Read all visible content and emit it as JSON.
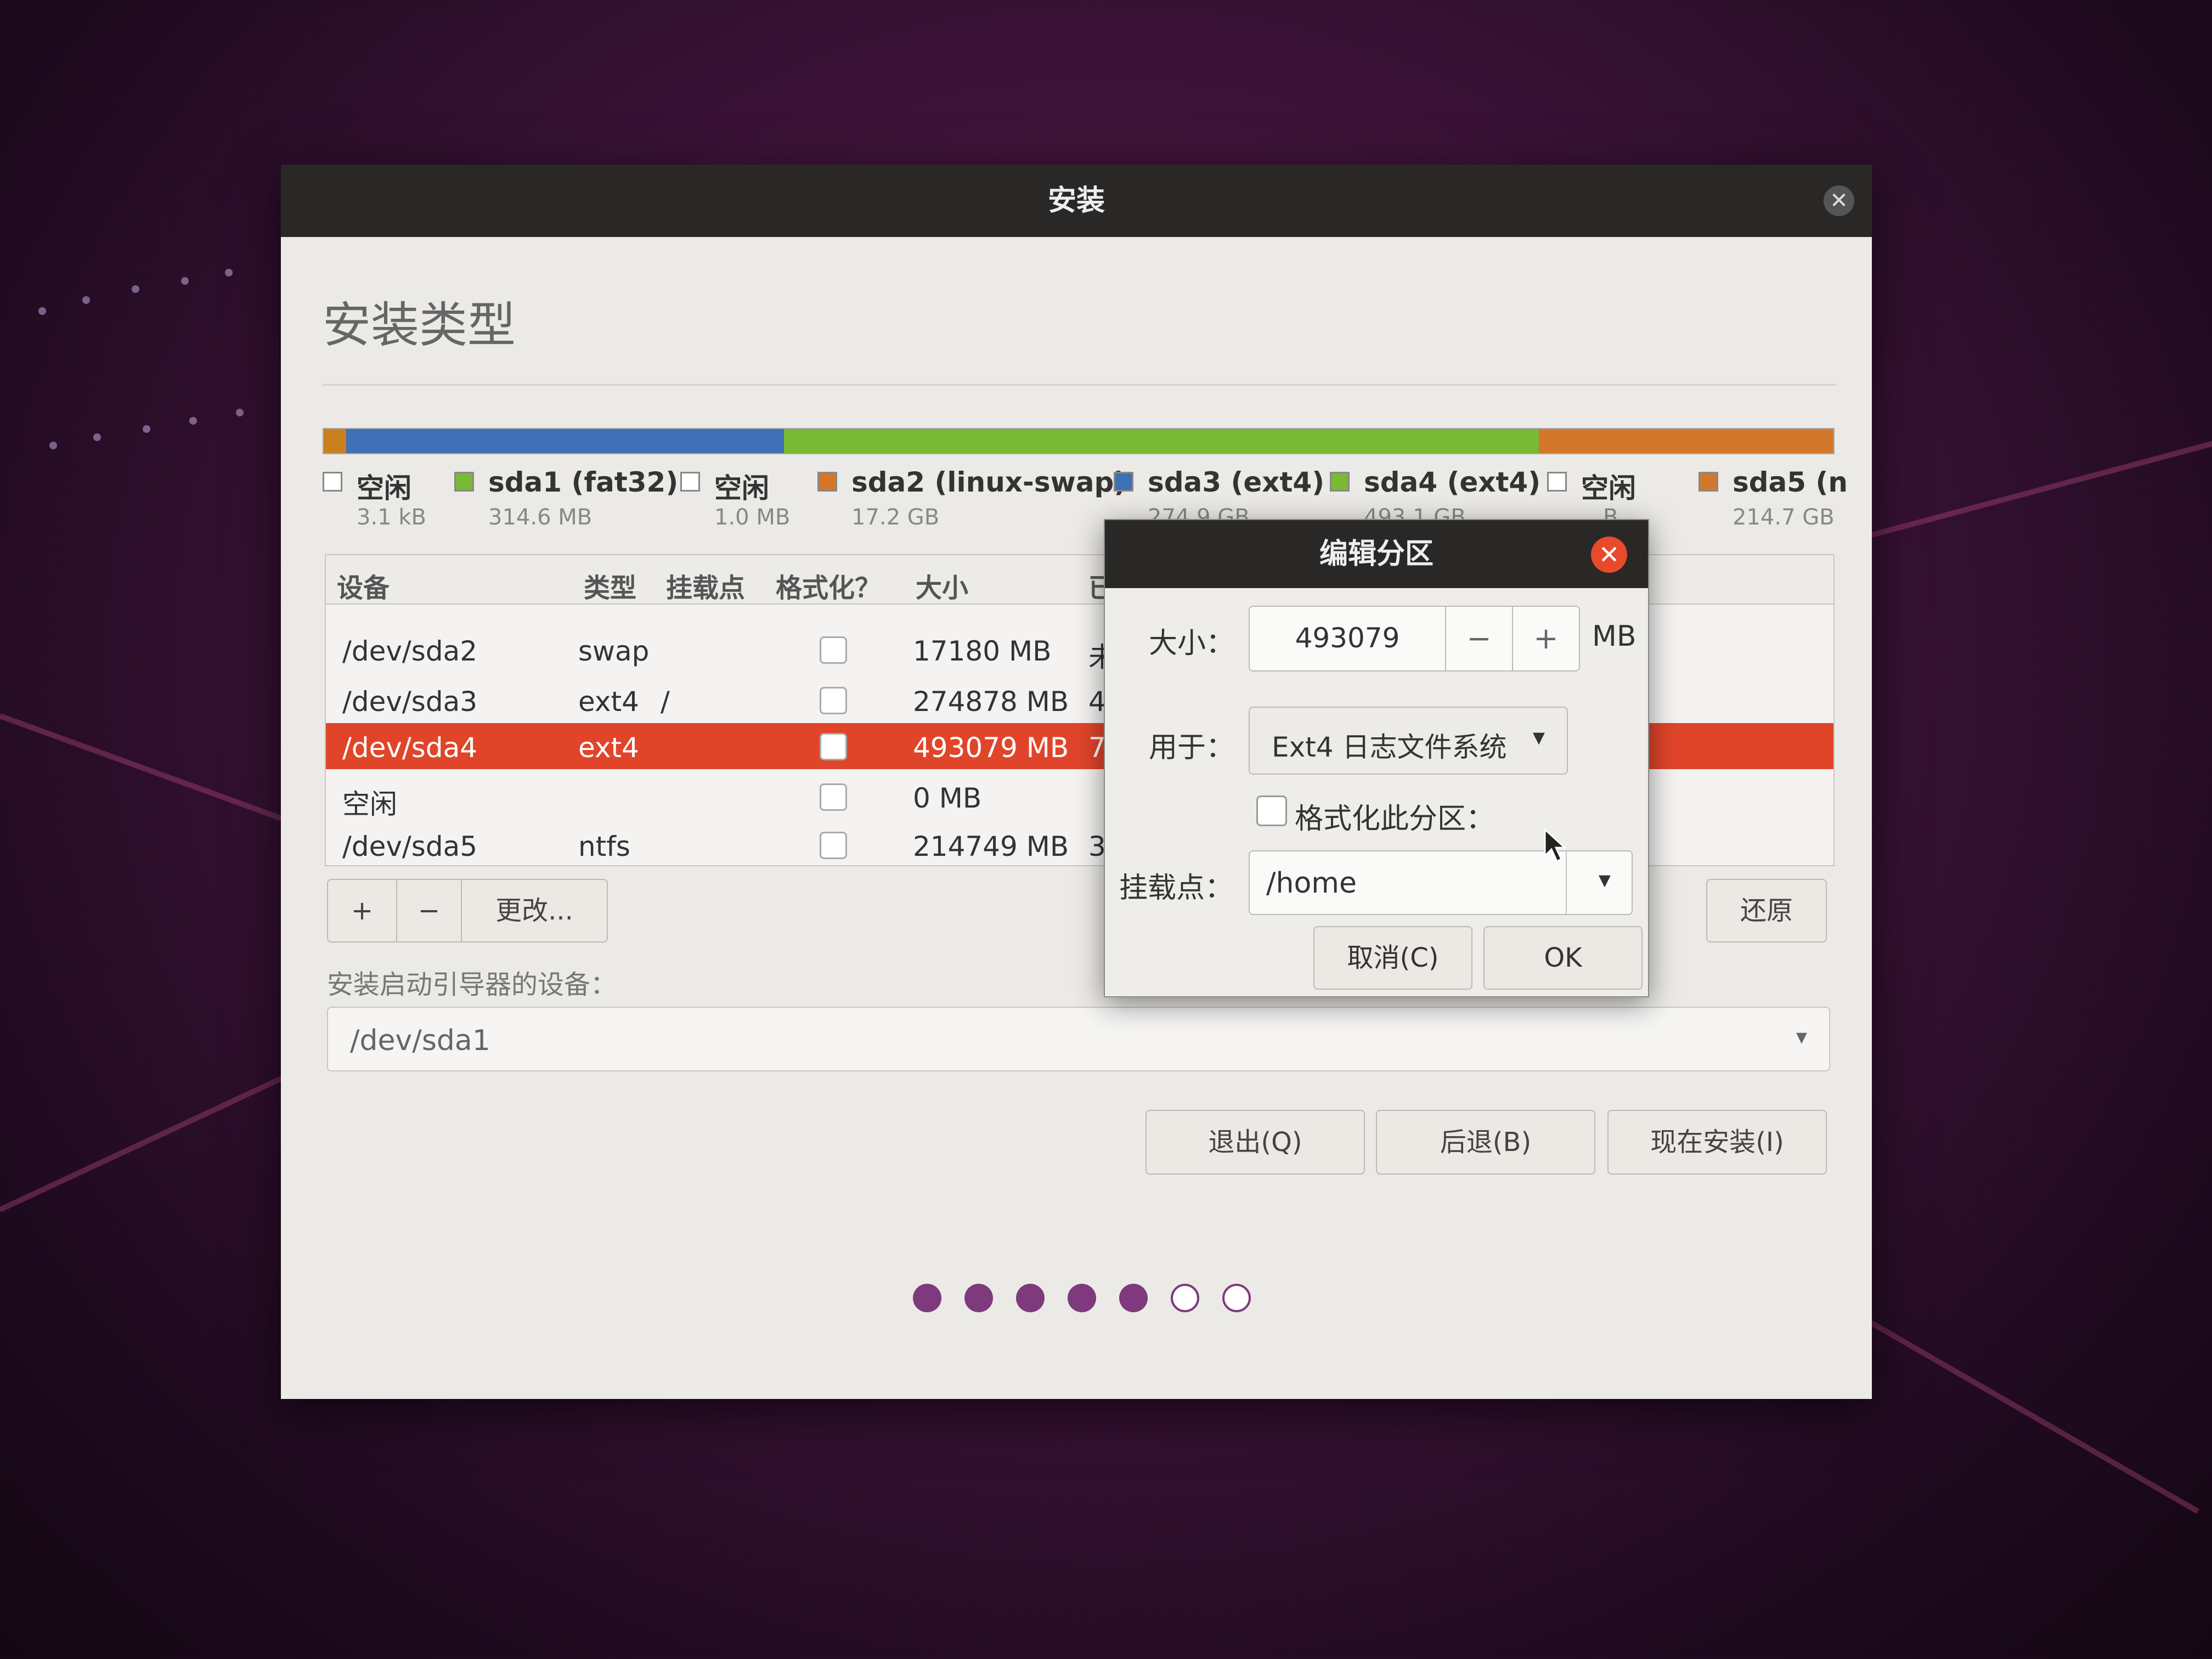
{
  "window": {
    "title": "安装",
    "page_title": "安装类型"
  },
  "partition_bar": [
    {
      "color": "#c9801e",
      "frac": 0.015
    },
    {
      "color": "#3f6fb4",
      "frac": 0.29
    },
    {
      "color": "#79b934",
      "frac": 0.5
    },
    {
      "color": "#d3782a",
      "frac": 0.195
    }
  ],
  "legend": [
    {
      "name": "空闲",
      "size": "3.1 kB",
      "color": "#ffffff"
    },
    {
      "name": "sda1 (fat32)",
      "size": "314.6 MB",
      "color": "#79b934"
    },
    {
      "name": "空闲",
      "size": "1.0 MB",
      "color": "#ffffff"
    },
    {
      "name": "sda2 (linux-swap)",
      "size": "17.2 GB",
      "color": "#d3782a"
    },
    {
      "name": "sda3 (ext4)",
      "size": "274.9 GB",
      "color": "#3f6fb4"
    },
    {
      "name": "sda4 (ext4)",
      "size": "493.1 GB",
      "color": "#79b934"
    },
    {
      "name": "空闲",
      "size": "…B",
      "color": "#ffffff"
    },
    {
      "name": "sda5 (n",
      "size": "214.7 GB",
      "color": "#d3782a"
    }
  ],
  "table": {
    "headers": [
      "设备",
      "类型",
      "挂载点",
      "格式化？",
      "大小",
      "已"
    ],
    "rows": [
      {
        "device": "/dev/sda2",
        "type": "swap",
        "mount": "",
        "size": "17180 MB",
        "used": "未"
      },
      {
        "device": "/dev/sda3",
        "type": "ext4",
        "mount": "/",
        "size": "274878 MB",
        "used": "45"
      },
      {
        "device": "/dev/sda4",
        "type": "ext4",
        "mount": "",
        "size": "493079 MB",
        "used": "79"
      },
      {
        "device": "空闲",
        "type": "",
        "mount": "",
        "size": "0 MB",
        "used": ""
      },
      {
        "device": "/dev/sda5",
        "type": "ntfs",
        "mount": "",
        "size": "214749 MB",
        "used": "3("
      }
    ]
  },
  "table_buttons": {
    "add": "+",
    "remove": "−",
    "change": "更改...",
    "revert": "还原"
  },
  "bootloader": {
    "label": "安装启动引导器的设备：",
    "value": "/dev/sda1"
  },
  "nav_buttons": {
    "quit": "退出(Q)",
    "back": "后退(B)",
    "install": "现在安装(I)"
  },
  "progress": {
    "total": 7,
    "done": 5
  },
  "dialog": {
    "title": "编辑分区",
    "size_label": "大小：",
    "size_value": "493079",
    "size_minus": "−",
    "size_plus": "+",
    "size_unit": "MB",
    "use_label": "用于：",
    "use_value": "Ext4 日志文件系统",
    "format_label": "格式化此分区：",
    "mount_label": "挂载点：",
    "mount_value": "/home",
    "cancel": "取消(C)",
    "ok": "OK"
  }
}
